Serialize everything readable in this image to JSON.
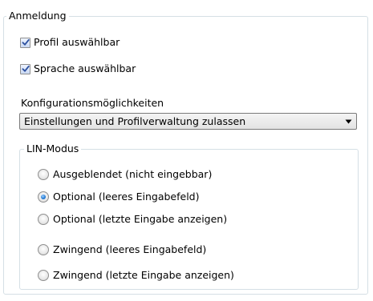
{
  "anmeldung": {
    "title": "Anmeldung",
    "checkboxes": [
      {
        "label": "Profil auswählbar",
        "checked": true
      },
      {
        "label": "Sprache auswählbar",
        "checked": true
      }
    ],
    "konfig": {
      "label": "Konfigurationsmöglichkeiten",
      "selected": "Einstellungen und Profilverwaltung zulassen"
    }
  },
  "lin_modus": {
    "title": "LIN-Modus",
    "options": [
      {
        "label": "Ausgeblendet (nicht eingebbar)",
        "selected": false
      },
      {
        "label": "Optional (leeres Eingabefeld)",
        "selected": true
      },
      {
        "label": "Optional (letzte Eingabe anzeigen)",
        "selected": false
      },
      {
        "label": "Zwingend (leeres Eingabefeld)",
        "selected": false
      },
      {
        "label": "Zwingend (letzte Eingabe anzeigen)",
        "selected": false
      }
    ]
  },
  "icons": {
    "check": "check-icon",
    "dropdown": "chevron-down-icon",
    "radio_dot": "radio-dot-icon"
  },
  "colors": {
    "groupbox_border": "#d5dfe5",
    "check_mark": "#2b4f9e",
    "radio_selected": "#2a7fd6"
  }
}
